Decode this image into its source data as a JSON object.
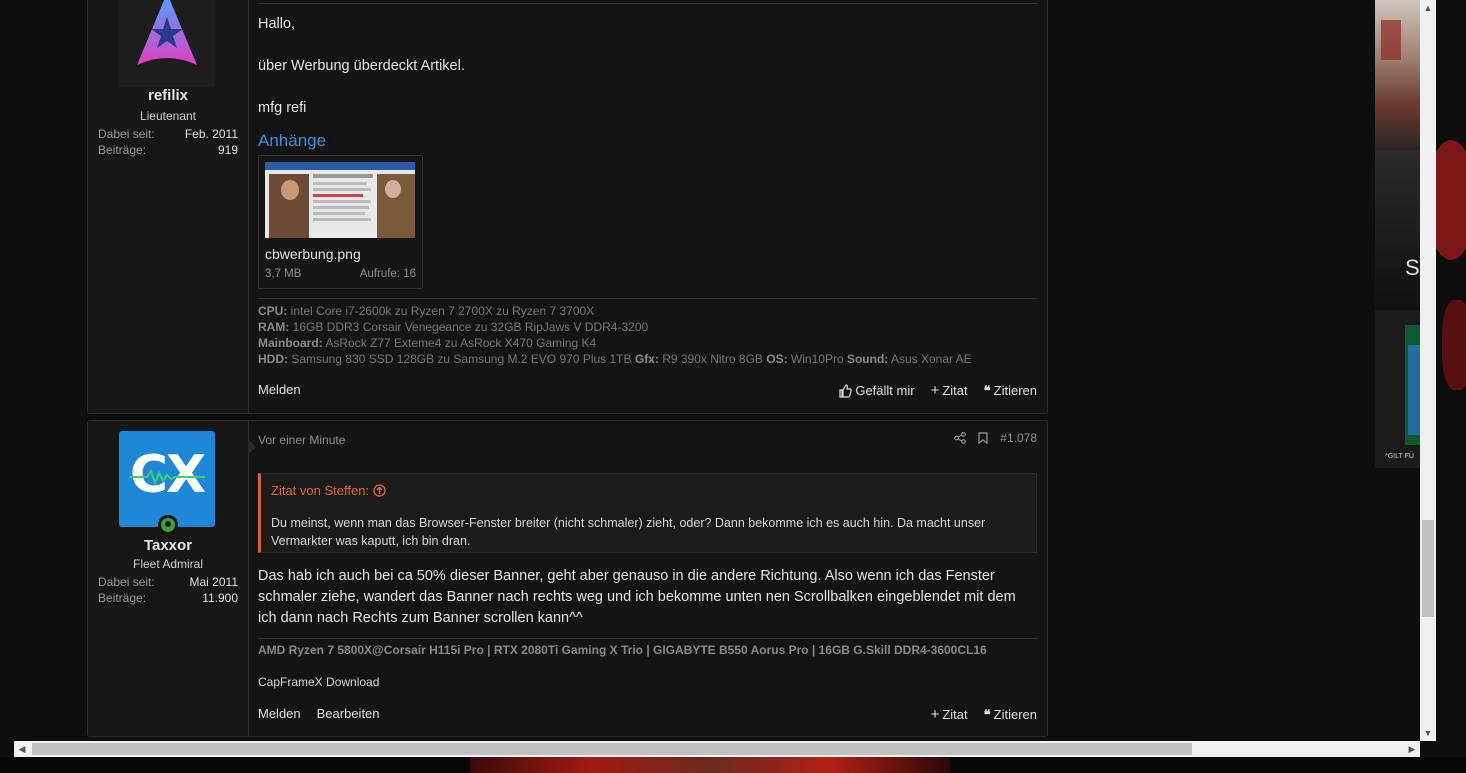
{
  "post1": {
    "user": {
      "name": "refilix",
      "title": "Lieutenant",
      "joined_label": "Dabei seit:",
      "joined": "Feb. 2011",
      "posts_label": "Beiträge:",
      "posts": "919"
    },
    "lines": [
      "Hallo,",
      "über Werbung überdeckt Artikel.",
      "mfg refi"
    ],
    "attachments_heading": "Anhänge",
    "attachment": {
      "filename": "cbwerbung.png",
      "size": "3,7 MB",
      "views": "Aufrufe: 16"
    },
    "signature": [
      {
        "label": "CPU:",
        "text": " intel Core i7-2600k zu Ryzen 7 2700X zu Ryzen 7 3700X"
      },
      {
        "label": "RAM:",
        "text": " 16GB DDR3 Corsair Venegeance zu 32GB RipJaws V DDR4-3200"
      },
      {
        "label": "Mainboard:",
        "text": " AsRock Z77 Exteme4 zu AsRock X470 Gaming K4"
      }
    ],
    "signature_hdd": {
      "l1": "HDD:",
      "t1": " Samsung 830 SSD 128GB zu Samsung M.2 EVO 970 Plus 1TB ",
      "l2": "Gfx:",
      "t2": " R9 390x Nitro 8GB ",
      "l3": "OS:",
      "t3": " Win10Pro ",
      "l4": "Sound:",
      "t4": " Asus Xonar AE"
    },
    "actions": {
      "report": "Melden",
      "like": "Gefällt mir",
      "quote": "Zitat",
      "reply": "Zitieren"
    }
  },
  "post2": {
    "user": {
      "name": "Taxxor",
      "title": "Fleet Admiral",
      "joined_label": "Dabei seit:",
      "joined": "Mai 2011",
      "posts_label": "Beiträge:",
      "posts": "11.900"
    },
    "time": "Vor einer Minute",
    "post_number": "#1.078",
    "quote": {
      "author": "Zitat von Steffen:",
      "text_line1": "Du meinst, wenn man das Browser-Fenster breiter (nicht schmaler) zieht, oder? Dann bekomme ich es auch hin. Da macht unser",
      "text_line2": "Vermarkter was kaputt, ich bin dran."
    },
    "body_line1": "Das hab ich auch bei ca 50% dieser Banner, geht aber genauso in die andere Richtung. Also wenn ich das Fenster",
    "body_line2": "schmaler ziehe, wandert das Banner nach rechts weg und ich bekomme unten nen Scrollbalken eingeblendet mit dem",
    "body_line3": "ich dann nach Rechts zum Banner scrollen kann^^",
    "signature": "AMD Ryzen 7 5800X@Corsair H115i Pro | RTX 2080Ti Gaming X Trio | GIGABYTE B550 Aorus Pro | 16GB G.Skill DDR4-3600CL16",
    "signature_link": "CapFrameX Download",
    "avatar_text": "CX",
    "actions": {
      "report": "Melden",
      "edit": "Bearbeiten",
      "quote": "Zitat",
      "reply": "Zitieren"
    }
  },
  "ad": {
    "footnote": "*GILT FÜ"
  },
  "colors": {
    "link": "#3b8fd8",
    "quote_accent": "#d9622b",
    "online": "#3aa33a",
    "avatar_bg": "#1e88d6"
  }
}
